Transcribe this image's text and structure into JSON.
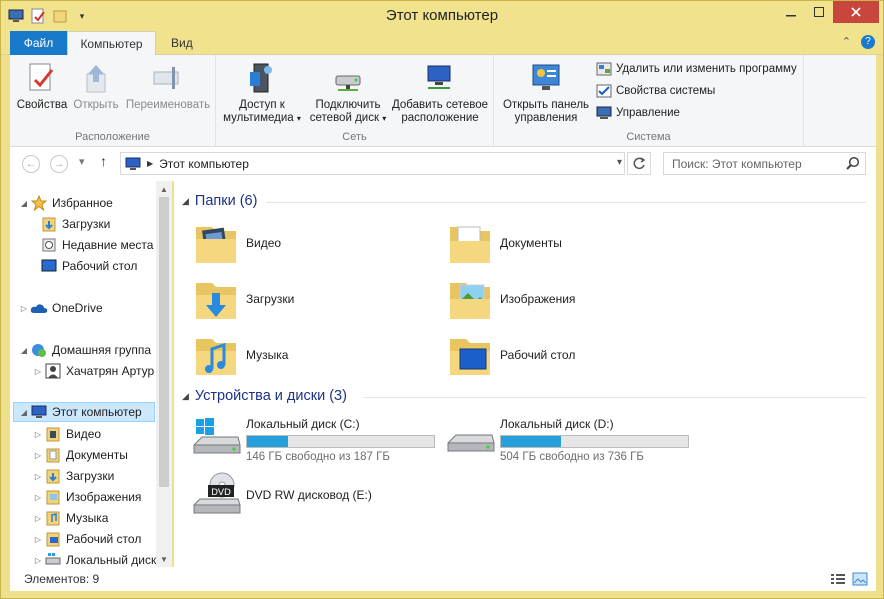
{
  "window": {
    "title": "Этот компьютер"
  },
  "tabs": {
    "file": "Файл",
    "computer": "Компьютер",
    "view": "Вид"
  },
  "ribbon": {
    "location": {
      "label": "Расположение",
      "properties": "Свойства",
      "open": "Открыть",
      "rename": "Переименовать"
    },
    "network": {
      "label": "Сеть",
      "media_line1": "Доступ к",
      "media_line2": "мультимедиа",
      "map_line1": "Подключить",
      "map_line2": "сетевой диск",
      "add_line1": "Добавить сетевое",
      "add_line2": "расположение"
    },
    "system": {
      "label": "Система",
      "cp_line1": "Открыть панель",
      "cp_line2": "управления",
      "uninstall": "Удалить или изменить программу",
      "sysprops": "Свойства системы",
      "manage": "Управление"
    }
  },
  "address": {
    "path": "Этот компьютер",
    "search_placeholder": "Поиск: Этот компьютер"
  },
  "nav": {
    "favorites": "Избранное",
    "downloads": "Загрузки",
    "recent": "Недавние места",
    "desktop": "Рабочий стол",
    "onedrive": "OneDrive",
    "homegroup": "Домашняя группа",
    "user": "Хачатрян Артур",
    "thispc": "Этот компьютер",
    "video": "Видео",
    "documents": "Документы",
    "downloads2": "Загрузки",
    "images": "Изображения",
    "music": "Музыка",
    "desktop2": "Рабочий стол",
    "localdisk": "Локальный диск"
  },
  "content": {
    "folders_header": "Папки (6)",
    "folders": [
      "Видео",
      "Документы",
      "Загрузки",
      "Изображения",
      "Музыка",
      "Рабочий стол"
    ],
    "devices_header": "Устройства и диски (3)",
    "drives": [
      {
        "name": "Локальный диск (C:)",
        "free": "146 ГБ свободно из 187 ГБ",
        "used_fraction": 0.22
      },
      {
        "name": "Локальный диск (D:)",
        "free": "504 ГБ свободно из 736 ГБ",
        "used_fraction": 0.32
      }
    ],
    "dvd": {
      "name": "DVD RW дисковод (E:)",
      "badge": "DVD"
    }
  },
  "status": {
    "items": "Элементов: 9"
  },
  "colors": {
    "titlebar": "#f1e38d",
    "accent": "#1979ca",
    "progress": "#26a0da",
    "close": "#c7463e",
    "section": "#1e3287"
  }
}
